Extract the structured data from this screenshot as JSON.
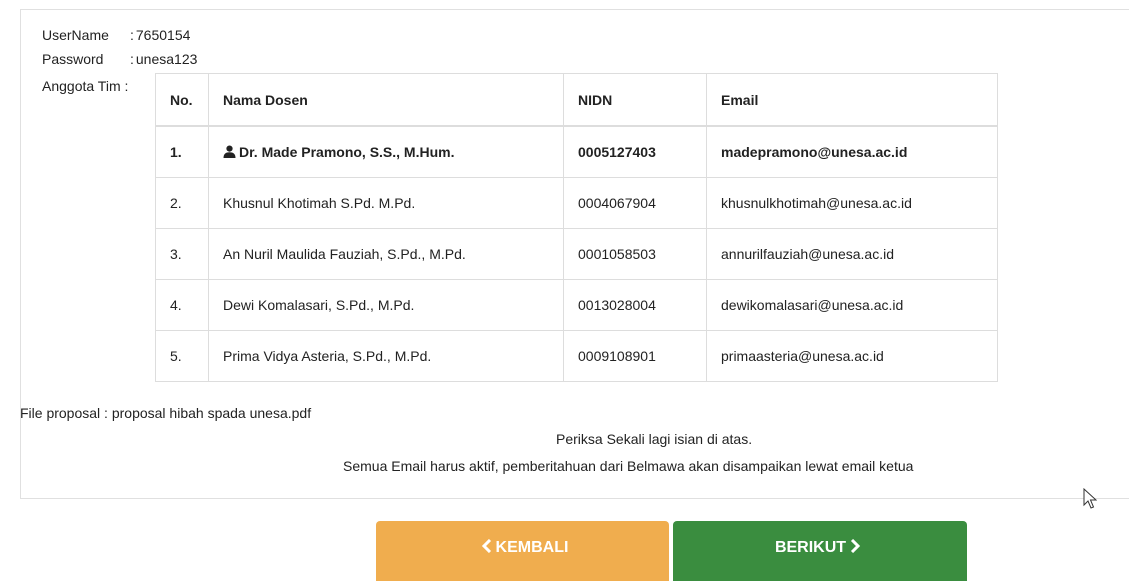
{
  "account": {
    "username_label": "UserName",
    "username_value": "7650154",
    "password_label": "Password",
    "password_value": "unesa123",
    "team_label": "Anggota Tim :"
  },
  "table": {
    "headers": [
      "No.",
      "Nama Dosen",
      "NIDN",
      "Email"
    ],
    "rows": [
      {
        "no": "1.",
        "name": "Dr. Made Pramono, S.S., M.Hum.",
        "nidn": "0005127403",
        "email": "madepramono@unesa.ac.id"
      },
      {
        "no": "2.",
        "name": "Khusnul Khotimah S.Pd. M.Pd.",
        "nidn": "0004067904",
        "email": "khusnulkhotimah@unesa.ac.id"
      },
      {
        "no": "3.",
        "name": "An Nuril Maulida Fauziah, S.Pd., M.Pd.",
        "nidn": "0001058503",
        "email": "annurilfauziah@unesa.ac.id"
      },
      {
        "no": "4.",
        "name": "Dewi Komalasari, S.Pd., M.Pd.",
        "nidn": "0013028004",
        "email": "dewikomalasari@unesa.ac.id"
      },
      {
        "no": "5.",
        "name": "Prima Vidya Asteria, S.Pd., M.Pd.",
        "nidn": "0009108901",
        "email": "primaasteria@unesa.ac.id"
      }
    ]
  },
  "proposal": {
    "label": "File proposal :",
    "filename": "proposal hibah spada unesa.pdf"
  },
  "notes": {
    "line1": "Periksa Sekali lagi isian di atas.",
    "line2": "Semua Email harus aktif, pemberitahuan dari Belmawa akan disampaikan lewat email ketua"
  },
  "buttons": {
    "back_label": "KEMBALI",
    "next_label": "BERIKUT",
    "back_color": "#f0ad4e",
    "next_color": "#3a8d3f"
  },
  "icons": {
    "leader": "user-icon",
    "back": "chevron-left-icon",
    "next": "chevron-right-icon",
    "cursor": "mouse-pointer-icon"
  }
}
